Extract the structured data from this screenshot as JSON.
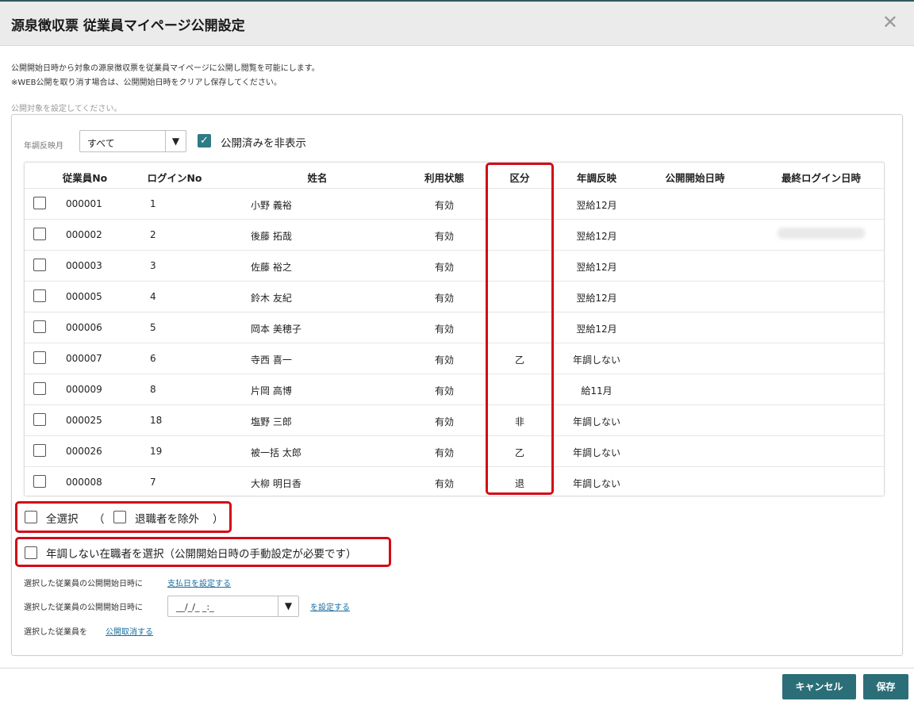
{
  "dialog": {
    "title": "源泉徴収票 従業員マイページ公開設定",
    "close_glyph": "✕",
    "desc1": "公開開始日時から対象の源泉徴収票を従業員マイページに公開し閲覧を可能にします。",
    "desc2": "※WEB公開を取り消す場合は、公開開始日時をクリアし保存してください。",
    "target_label": "公開対象を設定してください。"
  },
  "filter": {
    "month_label": "年調反映月",
    "month_value": "すべて",
    "hide_published_label": "公開済みを非表示",
    "hide_published_checked": true
  },
  "table": {
    "headers": [
      "従業員No",
      "ログインNo",
      "姓名",
      "利用状態",
      "区分",
      "年調反映",
      "公開開始日時",
      "最終ログイン日時"
    ],
    "rows": [
      {
        "emp": "000001",
        "login": "1",
        "name": "小野 義裕",
        "status": "有効",
        "kubun": "",
        "nencho": "翌給12月"
      },
      {
        "emp": "000002",
        "login": "2",
        "name": "後藤 拓哉",
        "status": "有効",
        "kubun": "",
        "nencho": "翌給12月"
      },
      {
        "emp": "000003",
        "login": "3",
        "name": "佐藤 裕之",
        "status": "有効",
        "kubun": "",
        "nencho": "翌給12月"
      },
      {
        "emp": "000005",
        "login": "4",
        "name": "鈴木 友紀",
        "status": "有効",
        "kubun": "",
        "nencho": "翌給12月"
      },
      {
        "emp": "000006",
        "login": "5",
        "name": "岡本 美穂子",
        "status": "有効",
        "kubun": "",
        "nencho": "翌給12月"
      },
      {
        "emp": "000007",
        "login": "6",
        "name": "寺西 喜一",
        "status": "有効",
        "kubun": "乙",
        "nencho": "年調しない"
      },
      {
        "emp": "000009",
        "login": "8",
        "name": "片岡 高博",
        "status": "有効",
        "kubun": "",
        "nencho": "給11月"
      },
      {
        "emp": "000025",
        "login": "18",
        "name": "塩野 三郎",
        "status": "有効",
        "kubun": "非",
        "nencho": "年調しない"
      },
      {
        "emp": "000026",
        "login": "19",
        "name": "被一括 太郎",
        "status": "有効",
        "kubun": "乙",
        "nencho": "年調しない"
      },
      {
        "emp": "000008",
        "login": "7",
        "name": "大柳 明日香",
        "status": "有効",
        "kubun": "退",
        "nencho": "年調しない"
      }
    ]
  },
  "options": {
    "select_all": "全選択",
    "paren_open": "（",
    "exclude_retired": "退職者を除外",
    "paren_close": "）",
    "select_no_nencho": "年調しない在職者を選択（公開開始日時の手動設定が必要です）"
  },
  "actions": {
    "line1_text": "選択した従業員の公開開始日時に",
    "line1_link": "支払日を設定する",
    "line2_text": "選択した従業員の公開開始日時に",
    "date_placeholder": "__/_/_ _:_",
    "line2_link": "を設定する",
    "line3_text": "選択した従業員を",
    "line3_link": "公開取消する"
  },
  "footer": {
    "cancel": "キャンセル",
    "save": "保存"
  },
  "colors": {
    "accent": "#2b6e78",
    "highlight": "#d20a16"
  }
}
